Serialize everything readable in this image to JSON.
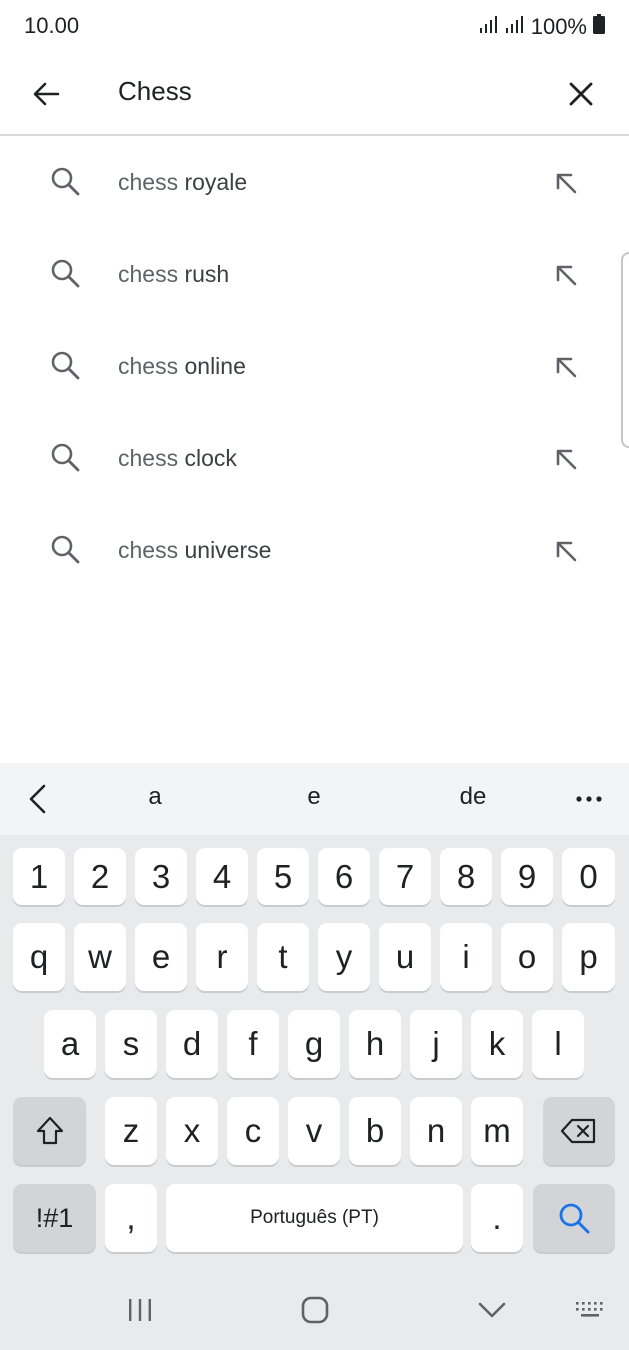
{
  "status_bar": {
    "time": "10.00",
    "battery": "100%"
  },
  "search": {
    "query": "Chess"
  },
  "suggestions": [
    {
      "prefix": "chess",
      "completion": " royale"
    },
    {
      "prefix": "chess",
      "completion": " rush"
    },
    {
      "prefix": "chess",
      "completion": " online"
    },
    {
      "prefix": "chess",
      "completion": " clock"
    },
    {
      "prefix": "chess",
      "completion": " universe"
    }
  ],
  "keyboard": {
    "predictions": [
      "a",
      "e",
      "de"
    ],
    "row_numbers": [
      "1",
      "2",
      "3",
      "4",
      "5",
      "6",
      "7",
      "8",
      "9",
      "0"
    ],
    "row_top": [
      "q",
      "w",
      "e",
      "r",
      "t",
      "y",
      "u",
      "i",
      "o",
      "p"
    ],
    "row_middle": [
      "a",
      "s",
      "d",
      "f",
      "g",
      "h",
      "j",
      "k",
      "l"
    ],
    "row_bottom": [
      "z",
      "x",
      "c",
      "v",
      "b",
      "n",
      "m"
    ],
    "symbols_label": "!#1",
    "comma_label": ",",
    "space_label": "Português (PT)",
    "period_label": ".",
    "accent_color": "#1a73e8"
  }
}
